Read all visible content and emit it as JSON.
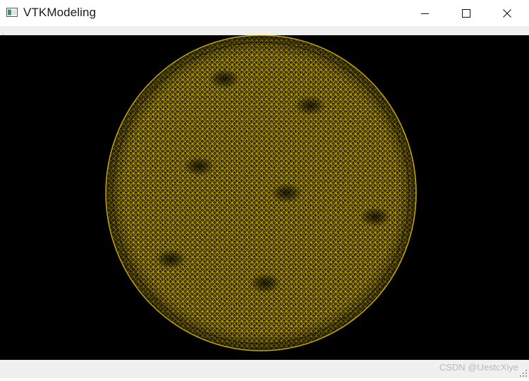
{
  "window": {
    "title": "VTKModeling",
    "controls": {
      "minimize_icon": "minimize-icon",
      "maximize_icon": "maximize-icon",
      "close_icon": "close-icon"
    }
  },
  "render_view": {
    "background_color": "#000000",
    "mesh_color": "#e0c200",
    "object": "circular-wireframe-mesh"
  },
  "status_bar": {
    "watermark": "CSDN @UestcXiye"
  }
}
